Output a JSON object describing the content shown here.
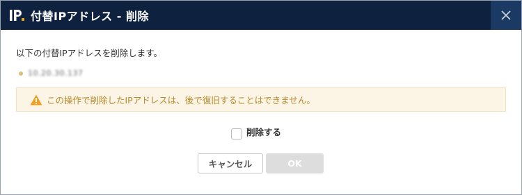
{
  "dialog": {
    "title": "付替IPアドレス - 削除",
    "logo_icon": "ip-logo-icon",
    "close_icon": "close-icon",
    "colors": {
      "titlebar": "#0e2240",
      "close_button": "#1b3a63",
      "warning_background": "#fcf4e4",
      "warning_text": "#b58a2e"
    }
  },
  "body": {
    "message": "以下の付替IPアドレスを削除します。",
    "ip_address": "10.20.30.137"
  },
  "warning": {
    "icon": "warning-triangle-icon",
    "text": "この操作で削除したIPアドレスは、後で復旧することはできません。"
  },
  "confirm": {
    "checkbox_label": "削除する",
    "checked": false
  },
  "buttons": {
    "cancel_label": "キャンセル",
    "ok_label": "OK"
  }
}
